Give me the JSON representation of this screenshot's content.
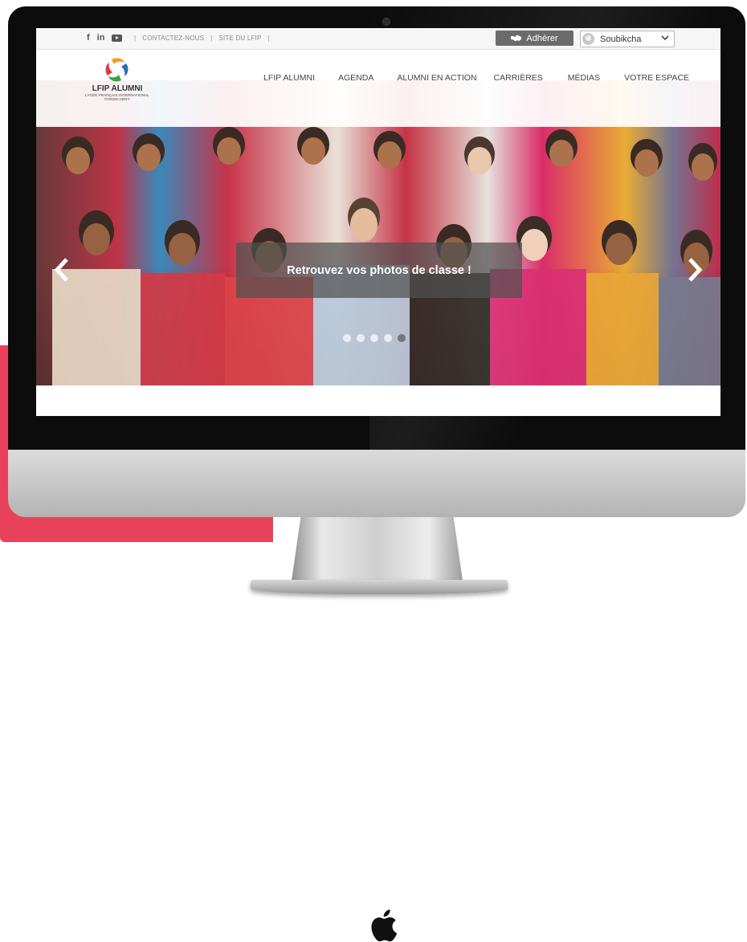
{
  "topbar": {
    "social": [
      "f",
      "in"
    ],
    "links": [
      "CONTACTEZ-NOUS",
      "SITE DU LFIP"
    ],
    "join_label": "Adhérer",
    "user_name": "Soubikcha"
  },
  "logo": {
    "title": "LFIP ALUMNI",
    "subtitle": "LYCÉE FRANÇAIS INTERNATIONAL",
    "city": "PONDICHERY"
  },
  "nav": [
    "LFIP ALUMNI",
    "AGENDA",
    "ALUMNI EN ACTION",
    "CARRIÈRES",
    "MÉDIAS",
    "VOTRE ESPACE"
  ],
  "hero": {
    "caption": "Retrouvez vos photos de classe !",
    "slide_count": 5,
    "active_slide": 5
  },
  "colors": {
    "accent_pink": "#e8425a",
    "join_button": "#6b6b6b",
    "logo_orange": "#f39a1e",
    "logo_blue": "#2a6ebb",
    "logo_red": "#e03a3e",
    "logo_green": "#3aa245"
  },
  "icons": [
    "facebook-icon",
    "linkedin-icon",
    "youtube-icon",
    "handshake-icon",
    "chevron-down-icon",
    "chevron-left-icon",
    "chevron-right-icon",
    "apple-logo-icon"
  ]
}
